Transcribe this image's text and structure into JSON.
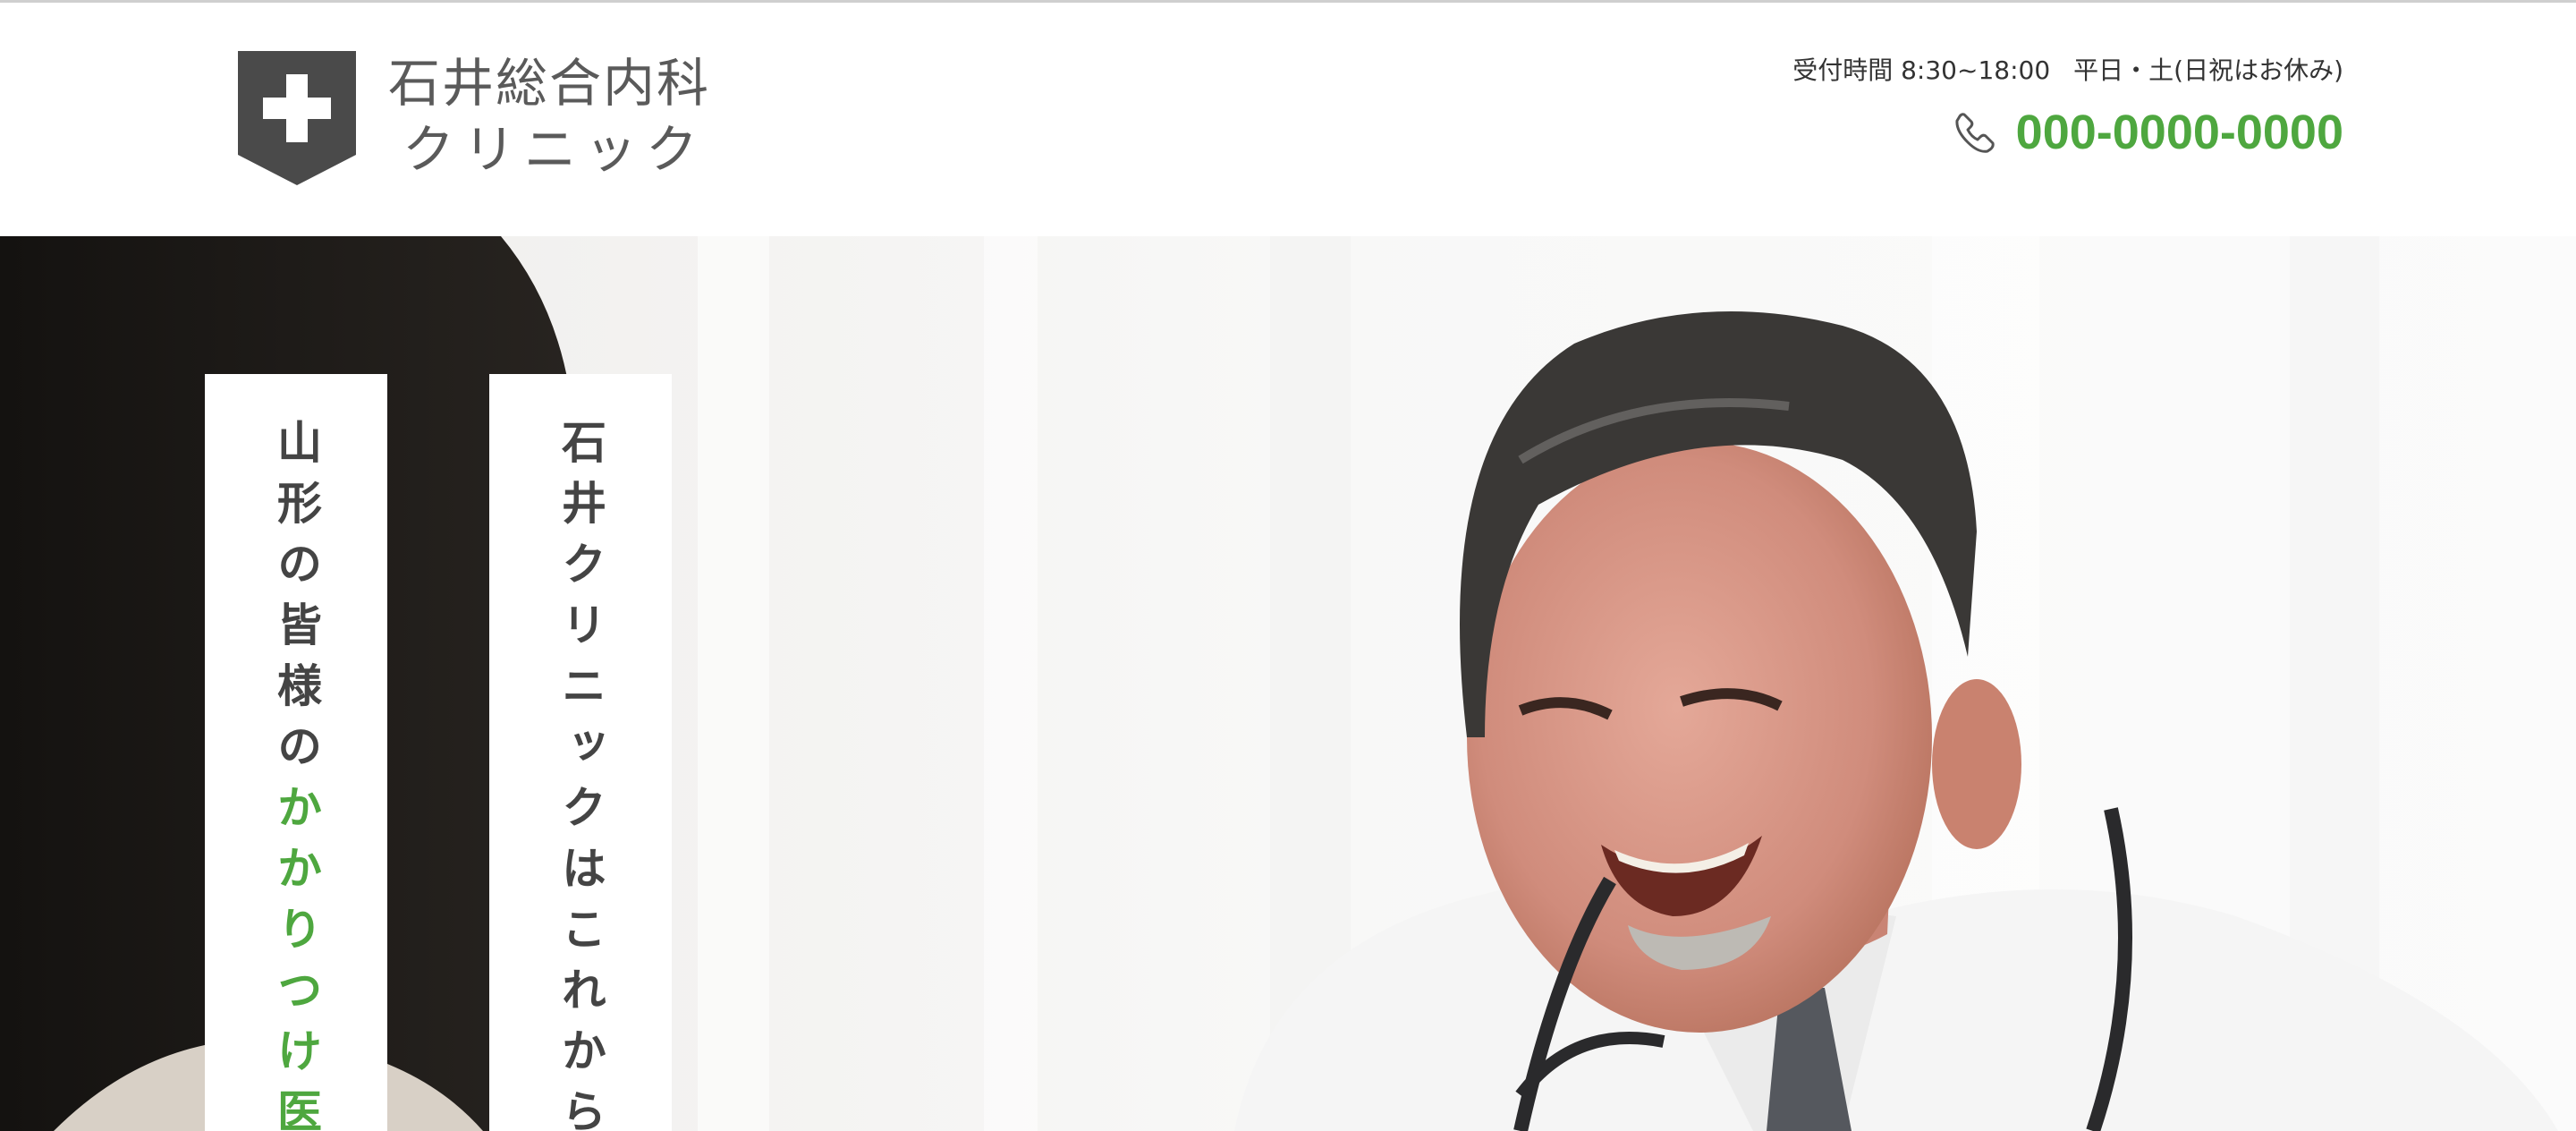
{
  "header": {
    "clinic_name_line1": "石井総合内科",
    "clinic_name_line2": "クリニック",
    "hours_label": "受付時間 8:30~18:00",
    "hours_days": "平日・土(日祝はお休み)",
    "phone": "000-0000-0000"
  },
  "hero": {
    "tagline_part1": "山形の皆様の",
    "tagline_highlight": "かかりつけ医",
    "tagline2": "石井クリニックはこれから"
  },
  "colors": {
    "accent_green": "#4ea73f",
    "logo_gray": "#4a4a4a",
    "text_dark": "#444444"
  },
  "icons": {
    "logo": "medical-cross-shield-icon",
    "phone": "phone-icon"
  }
}
